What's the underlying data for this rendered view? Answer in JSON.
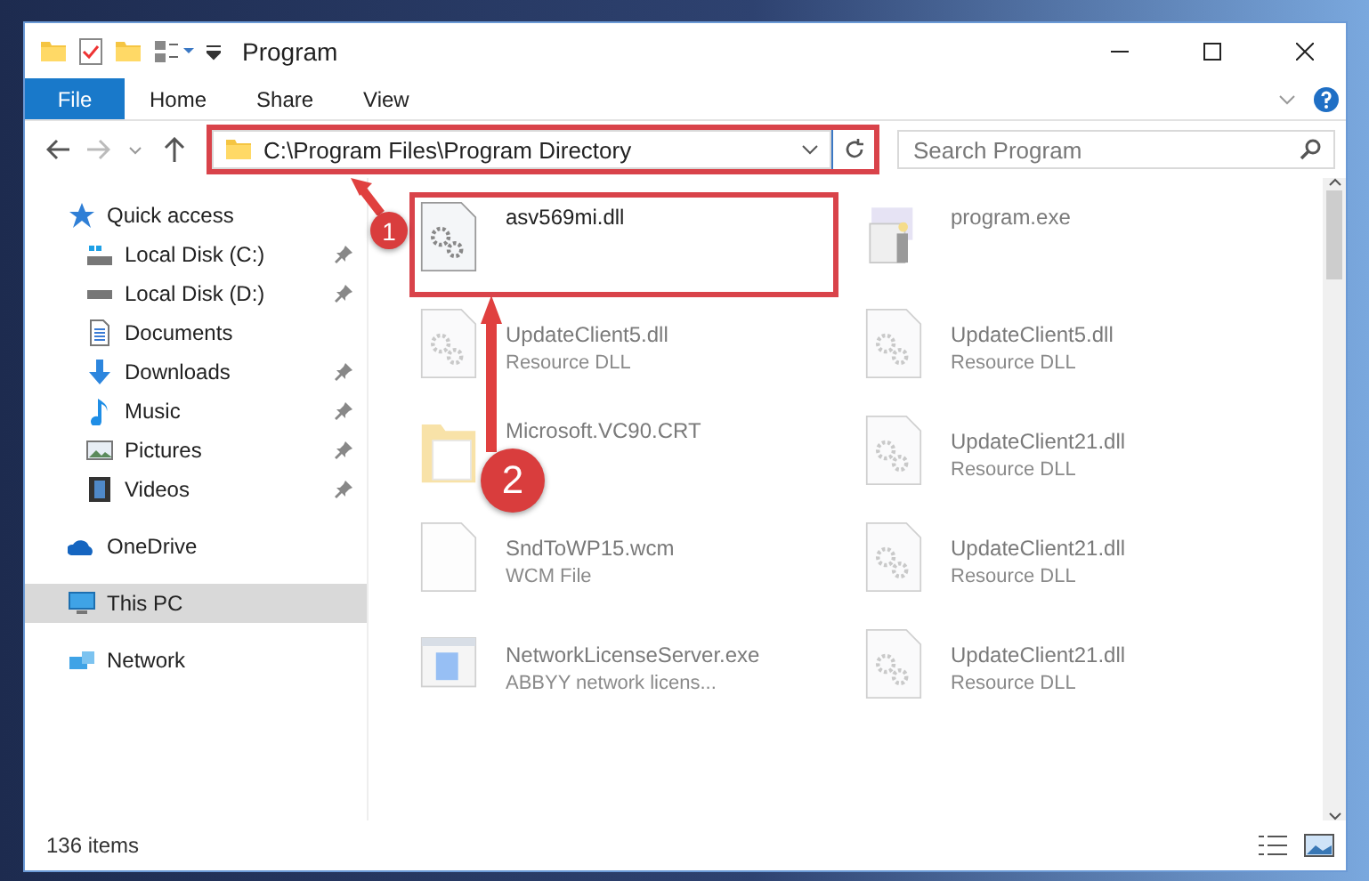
{
  "window": {
    "title": "Program"
  },
  "ribbon_tabs": [
    {
      "label": "File",
      "selected": true
    },
    {
      "label": "Home",
      "selected": false
    },
    {
      "label": "Share",
      "selected": false
    },
    {
      "label": "View",
      "selected": false
    }
  ],
  "address": {
    "path": "C:\\Program Files\\Program Directory",
    "highlighted": true
  },
  "search": {
    "placeholder": "Search Program"
  },
  "sidebar": {
    "items": [
      {
        "label": "Quick access",
        "kind": "star",
        "selected": false,
        "children": [
          {
            "label": "Local Disk (C:)",
            "kind": "disk-c",
            "pinned": true,
            "selected": false
          },
          {
            "label": "Local Disk (D:)",
            "kind": "disk",
            "pinned": true,
            "selected": false
          },
          {
            "label": "Documents",
            "kind": "documents",
            "pinned": false,
            "selected": false
          },
          {
            "label": "Downloads",
            "kind": "downloads",
            "pinned": true,
            "selected": false
          },
          {
            "label": "Music",
            "kind": "music",
            "pinned": true,
            "selected": false
          },
          {
            "label": "Pictures",
            "kind": "pictures",
            "pinned": true,
            "selected": false
          },
          {
            "label": "Videos",
            "kind": "videos",
            "pinned": true,
            "selected": false
          }
        ]
      },
      {
        "label": "OneDrive",
        "kind": "cloud",
        "selected": false
      },
      {
        "label": "This PC",
        "kind": "pc",
        "selected": true
      },
      {
        "label": "Network",
        "kind": "network",
        "selected": false
      }
    ]
  },
  "files": [
    {
      "name": "asv569mi.dll",
      "kind": "dll",
      "dimmed": false,
      "highlighted": true
    },
    {
      "name": "program.exe",
      "kind": "exe",
      "dimmed": true,
      "highlighted": false
    },
    {
      "name": "UpdateClient5.dll",
      "type": "Resource DLL",
      "kind": "dll",
      "dimmed": true,
      "highlighted": false
    },
    {
      "name": "UpdateClient5.dll",
      "type": "Resource DLL",
      "kind": "dll",
      "dimmed": true,
      "highlighted": false
    },
    {
      "name": "Microsoft.VC90.CRT",
      "kind": "folder",
      "dimmed": true,
      "highlighted": false
    },
    {
      "name": "UpdateClient21.dll",
      "type": "Resource DLL",
      "kind": "dll",
      "dimmed": true,
      "highlighted": false
    },
    {
      "name": "SndToWP15.wcm",
      "type": "WCM File",
      "kind": "file",
      "dimmed": true,
      "highlighted": false
    },
    {
      "name": "UpdateClient21.dll",
      "type": "Resource DLL",
      "kind": "dll",
      "dimmed": true,
      "highlighted": false
    },
    {
      "name": "NetworkLicenseServer.exe",
      "type": "ABBYY network licens...",
      "kind": "app",
      "dimmed": true,
      "highlighted": false
    },
    {
      "name": "UpdateClient21.dll",
      "type": "Resource DLL",
      "kind": "dll",
      "dimmed": true,
      "highlighted": false
    }
  ],
  "status_bar": {
    "count": "136 items"
  },
  "annotations": [
    {
      "number": "1"
    },
    {
      "number": "2"
    }
  ]
}
